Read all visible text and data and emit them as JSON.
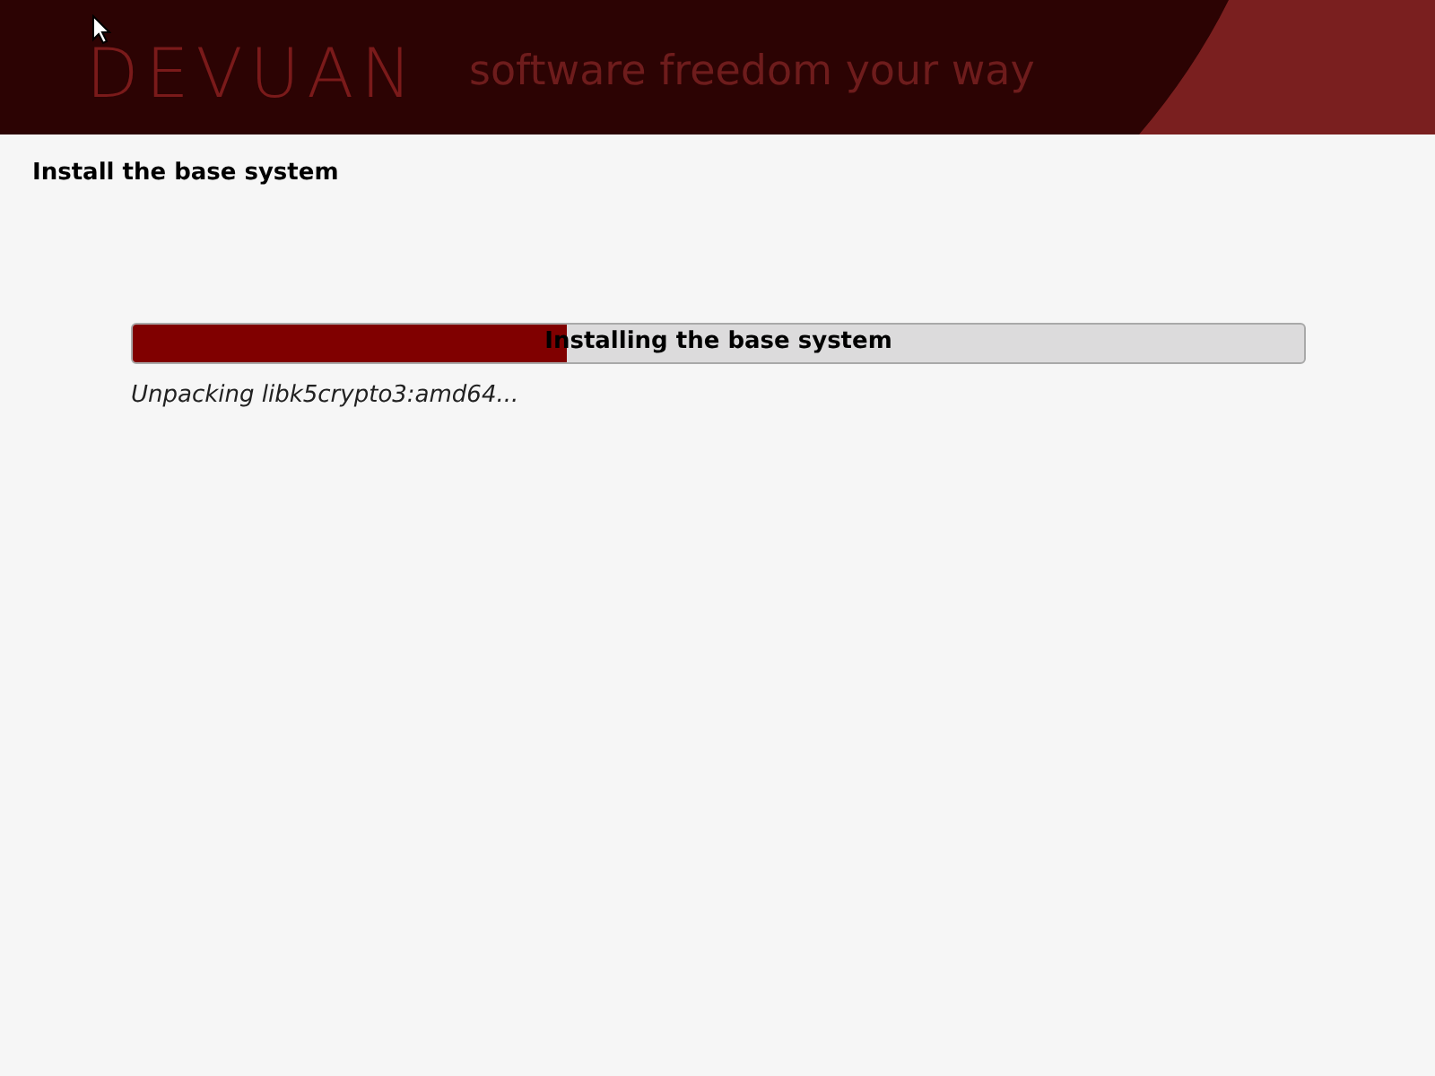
{
  "banner": {
    "logo": "DEVUAN",
    "tagline": "software freedom your way"
  },
  "title": "Install the base system",
  "progress": {
    "label": "Installing the base system",
    "level": 0.37
  },
  "status": "Unpacking libk5crypto3:amd64..."
}
